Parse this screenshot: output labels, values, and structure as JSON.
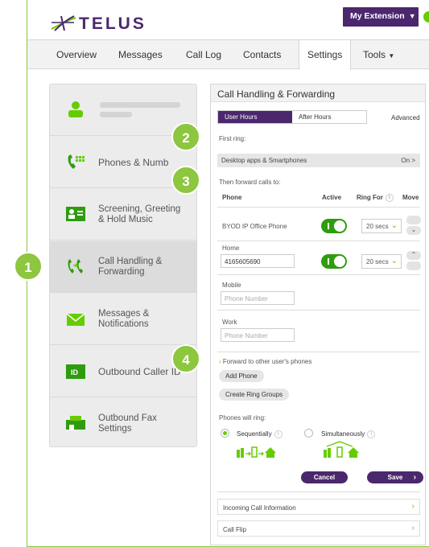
{
  "header": {
    "logo_text": "TELUS",
    "extension_button": "My Extension",
    "brand_color": "#4b286d",
    "accent_color": "#66cc00"
  },
  "nav": {
    "items": [
      "Overview",
      "Messages",
      "Call Log",
      "Contacts",
      "Settings",
      "Tools"
    ],
    "active": "Settings"
  },
  "menu": {
    "items": [
      {
        "label": "",
        "icon": "user-icon"
      },
      {
        "label": "Phones & Numb",
        "icon": "phone-grid-icon"
      },
      {
        "label": "Screening, Greeting\n& Hold Music",
        "icon": "screening-icon"
      },
      {
        "label": "Call Handling &\nForwarding",
        "icon": "call-forward-icon"
      },
      {
        "label": "Messages &\nNotifications",
        "icon": "envelope-icon"
      },
      {
        "label": "Outbound Caller ID",
        "icon": "id-badge-icon"
      },
      {
        "label": "Outbound Fax\nSettings",
        "icon": "fax-icon"
      }
    ]
  },
  "panel": {
    "title": "Call Handling & Forwarding",
    "tabs": [
      "User Hours",
      "After Hours"
    ],
    "advanced": "Advanced",
    "first_ring_label": "First ring:",
    "first_ring_option": "Desktop apps & Smartphones",
    "first_ring_status": "On",
    "forward_label": "Then forward calls to:",
    "columns": {
      "phone": "Phone",
      "active": "Active",
      "ring_for": "Ring For",
      "move": "Move"
    },
    "rows": [
      {
        "name": "BYOD IP Office Phone",
        "ring": "20 secs"
      },
      {
        "name": "Home",
        "value": "4165605690",
        "ring": "20 secs"
      }
    ],
    "mobile_label": "Mobile",
    "work_label": "Work",
    "phone_placeholder": "Phone Number",
    "forward_other": "Forward to other user's phones",
    "add_phone": "Add Phone",
    "create_groups": "Create Ring Groups",
    "phones_will_ring": "Phones will ring:",
    "sequentially": "Sequentially",
    "simultaneously": "Simultaneously",
    "cancel": "Cancel",
    "save": "Save",
    "incoming_info": "Incoming Call Information",
    "call_flip": "Call Flip"
  },
  "callouts": [
    "1",
    "2",
    "3",
    "4"
  ]
}
